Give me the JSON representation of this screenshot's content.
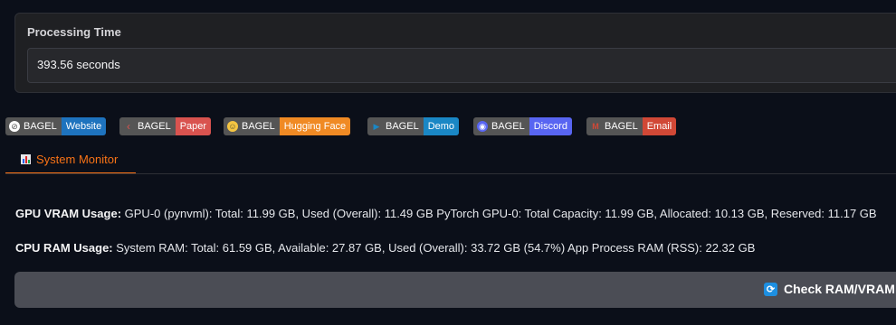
{
  "processing": {
    "label": "Processing Time",
    "value": "393.56 seconds"
  },
  "badges": [
    {
      "left": "BAGEL",
      "right": "Website",
      "color": "#1e73be",
      "icon": "compass-icon"
    },
    {
      "left": "BAGEL",
      "right": "Paper",
      "color": "#d9534f",
      "icon": "arxiv-icon"
    },
    {
      "left": "BAGEL",
      "right": "Hugging Face",
      "color": "#f08a24",
      "icon": "hugging-face-icon"
    },
    {
      "left": "BAGEL",
      "right": "Demo",
      "color": "#1a87c5",
      "icon": "play-icon"
    },
    {
      "left": "BAGEL",
      "right": "Discord",
      "color": "#5865f2",
      "icon": "discord-icon"
    },
    {
      "left": "BAGEL",
      "right": "Email",
      "color": "#d14836",
      "icon": "gmail-icon"
    }
  ],
  "tab": {
    "label": "System Monitor"
  },
  "gpu": {
    "title": "GPU VRAM Usage:",
    "text": " GPU-0 (pynvml): Total: 11.99 GB, Used (Overall): 11.49 GB PyTorch GPU-0: Total Capacity: 11.99 GB, Allocated: 10.13 GB, Reserved: 11.17 GB"
  },
  "cpu": {
    "title": "CPU RAM Usage:",
    "text": " System RAM: Total: 61.59 GB, Available: 27.87 GB, Used (Overall): 33.72 GB (54.7%) App Process RAM (RSS): 22.32 GB"
  },
  "check_button": {
    "label": "Check RAM/VRAM"
  }
}
